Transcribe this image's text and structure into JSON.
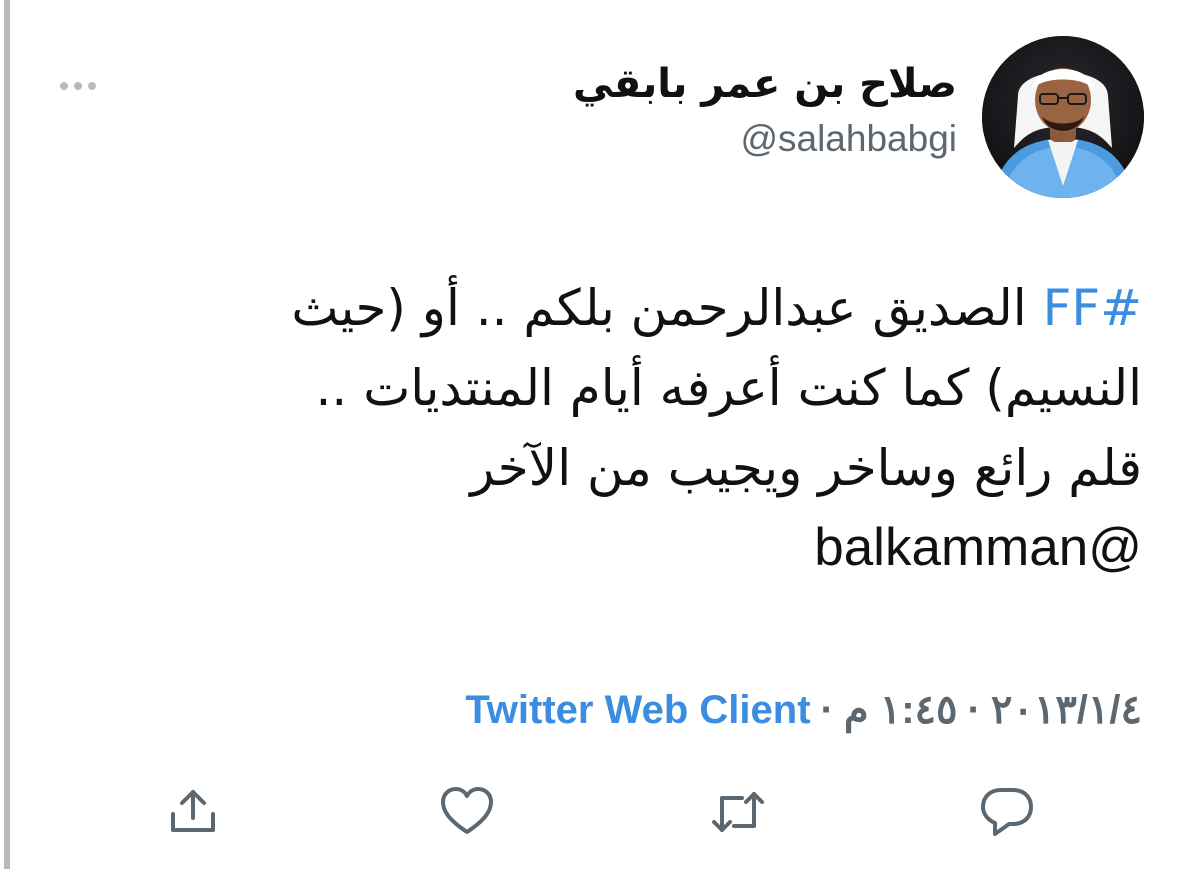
{
  "author": {
    "display_name": "صلاح بن عمر بابقي",
    "handle": "@salahbabgi"
  },
  "tweet": {
    "hashtag": "#FF",
    "line1_text": " الصديق عبدالرحمن بلكم .. أو (حيث",
    "line2_text": "النسيم) كما كنت أعرفه أيام المنتديات ..",
    "line3_text": "قلم رائع وساخر ويجيب من الآخر",
    "mention": "balkamman@"
  },
  "meta": {
    "date": "٢٠١٣/١/٤",
    "time": "١:٤٥ م",
    "separator": "·",
    "client": "Twitter Web Client"
  },
  "icons": {
    "more": "more-dots-icon",
    "reply": "reply-bubble-icon",
    "retweet": "retweet-icon",
    "like": "heart-icon",
    "share": "share-upload-icon"
  },
  "colors": {
    "link": "#3b8de0",
    "text": "#111111",
    "secondary": "#5c6770",
    "icon": "#5c6770"
  }
}
